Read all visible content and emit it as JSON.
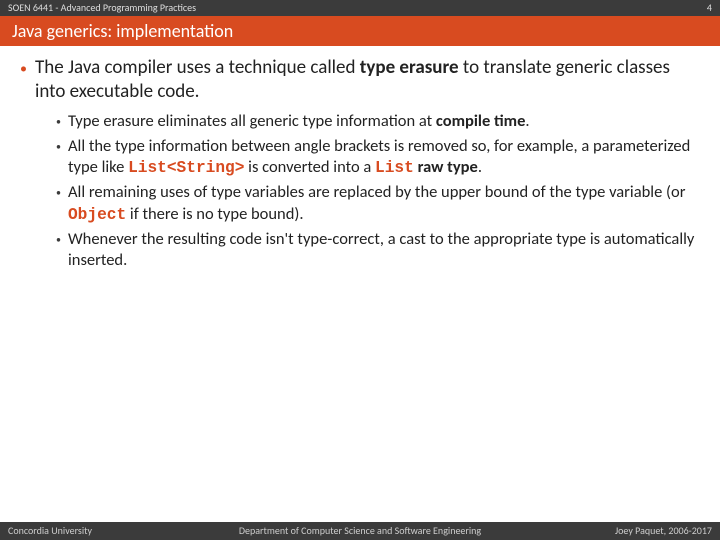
{
  "header": {
    "course": "SOEN 6441 - Advanced Programming Practices",
    "slide_number": "4",
    "title": "Java generics: implementation"
  },
  "main": {
    "pre1": "The Java compiler uses a technique called ",
    "bold1": "type erasure",
    "post1": " to translate generic classes into executable code.",
    "subs": {
      "s1_pre": "Type erasure eliminates all generic type information at ",
      "s1_bold": "compile time",
      "s1_post": ".",
      "s2_pre": "All the type information between angle brackets is removed so, for example, a parameterized type like ",
      "s2_code1": "List<String>",
      "s2_mid": " is converted into a ",
      "s2_code2": "List",
      "s2_sp": " ",
      "s2_bold": "raw type",
      "s2_post": ".",
      "s3_pre": "All remaining uses of type variables are replaced by the upper bound of the type variable (or ",
      "s3_code": "Object",
      "s3_post": " if there is no type bound).",
      "s4": "Whenever the resulting code isn't type-correct, a cast to the appropriate type is automatically inserted."
    }
  },
  "footer": {
    "left": "Concordia University",
    "center": "Department of Computer Science and Software Engineering",
    "right": "Joey Paquet, 2006-2017"
  }
}
